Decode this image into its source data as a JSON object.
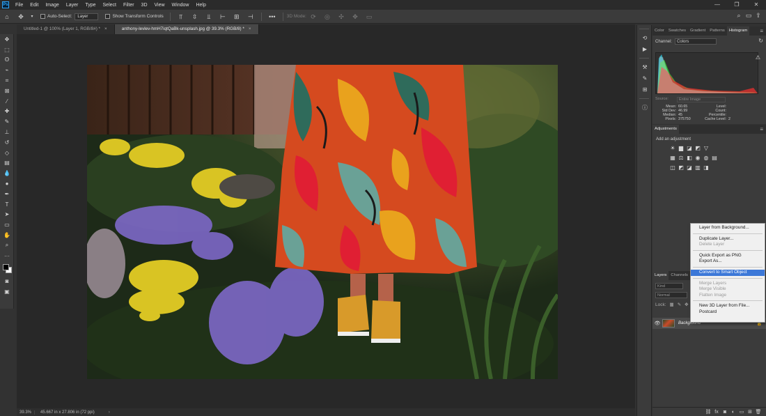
{
  "app": {
    "logo": "Ps"
  },
  "menu": [
    "File",
    "Edit",
    "Image",
    "Layer",
    "Type",
    "Select",
    "Filter",
    "3D",
    "View",
    "Window",
    "Help"
  ],
  "window_controls": [
    "—",
    "❐",
    "✕"
  ],
  "options_bar": {
    "auto_select_label": "Auto-Select:",
    "auto_select_target": "Layer",
    "show_transform_label": "Show Transform Controls",
    "mode_label": "3D Mode:"
  },
  "tabs": [
    {
      "label": "Untitled-1 @ 100% (Layer 1, RGB/8#) *"
    },
    {
      "label": "anthony-levlev-hmH7iqtQaBk-unsplash.jpg @ 39.3% (RGB/8) *"
    }
  ],
  "status": {
    "zoom": "39.3%",
    "info": "45.667 in x 27.806 in (72 ppi)",
    "arrow": "›"
  },
  "histogram_panel": {
    "tabs": [
      "Color",
      "Swatches",
      "Gradient",
      "Patterns",
      "Histogram"
    ],
    "active_tab": "Histogram",
    "channel_label": "Channel:",
    "channel_value": "Colors",
    "source_label": "Source:",
    "source_value": "Entire Image",
    "stats_left": [
      {
        "k": "Mean:",
        "v": "60.65"
      },
      {
        "k": "Std Dev:",
        "v": "46.99"
      },
      {
        "k": "Median:",
        "v": "45"
      },
      {
        "k": "Pixels:",
        "v": "375750"
      }
    ],
    "stats_right": [
      {
        "k": "Level:",
        "v": ""
      },
      {
        "k": "Count:",
        "v": ""
      },
      {
        "k": "Percentile:",
        "v": ""
      },
      {
        "k": "Cache Level:",
        "v": "2"
      }
    ]
  },
  "adjustments_panel": {
    "tab": "Adjustments",
    "subtitle": "Add an adjustment",
    "rows": [
      [
        "brightness-icon",
        "levels-icon",
        "curves-icon",
        "exposure-icon",
        "vibrance-icon"
      ],
      [
        "hue-sat-icon",
        "color-balance-icon",
        "bw-icon",
        "photo-filter-icon",
        "channel-mixer-icon",
        "color-lookup-icon"
      ],
      [
        "invert-icon",
        "posterize-icon",
        "threshold-icon",
        "selective-color-icon",
        "gradient-map-icon"
      ]
    ],
    "glyphs": [
      [
        "☀",
        "▆",
        "◪",
        "◩",
        "▽"
      ],
      [
        "▦",
        "⚖",
        "◧",
        "◉",
        "◍",
        "▤"
      ],
      [
        "◫",
        "◩",
        "◪",
        "▥",
        "◨"
      ]
    ]
  },
  "layers_panel": {
    "tabs": [
      "Layers",
      "Channels"
    ],
    "filter_placeholder": "Kind",
    "blend_mode": "Normal",
    "lock_label": "Lock:",
    "layer_name": "Background"
  },
  "context_menu": {
    "items": [
      {
        "label": "Layer from Background...",
        "state": "enabled"
      },
      {
        "sep": true
      },
      {
        "label": "Duplicate Layer...",
        "state": "enabled"
      },
      {
        "label": "Delete Layer",
        "state": "disabled"
      },
      {
        "sep": true
      },
      {
        "label": "Quick Export as PNG",
        "state": "enabled"
      },
      {
        "label": "Export As...",
        "state": "enabled"
      },
      {
        "sep": true
      },
      {
        "label": "Convert to Smart Object",
        "state": "highlighted"
      },
      {
        "sep": true
      },
      {
        "label": "Merge Layers",
        "state": "disabled"
      },
      {
        "label": "Merge Visible",
        "state": "disabled"
      },
      {
        "label": "Flatten Image",
        "state": "disabled"
      },
      {
        "sep": true
      },
      {
        "label": "New 3D Layer from File...",
        "state": "enabled"
      },
      {
        "label": "Postcard",
        "state": "enabled"
      }
    ]
  },
  "colors": {
    "highlight": "#3c78d8",
    "background": "#323232",
    "canvas": "#282828"
  }
}
